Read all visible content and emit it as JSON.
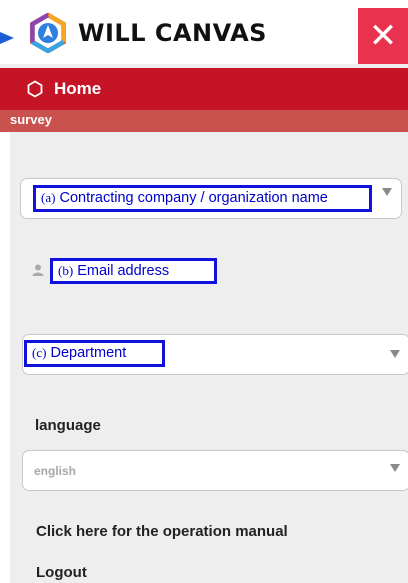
{
  "header": {
    "logo_text": "WILL CANVAS",
    "close_glyph": "✕",
    "colors": {
      "close_bg": "#e8324e",
      "nav_bg": "#c41425",
      "survey_bg": "#c9524f"
    }
  },
  "nav": {
    "home_label": "Home",
    "home_icon": "hexagon-outline-icon"
  },
  "survey_label": "survey",
  "fields": {
    "company": {
      "tag": "(a)",
      "label": "Contracting company / organization name"
    },
    "email": {
      "tag": "(b)",
      "label": "Email address",
      "icon": "person-icon"
    },
    "department": {
      "tag": "(c)",
      "label": "Department"
    }
  },
  "language": {
    "label": "language",
    "selected": "english"
  },
  "links": {
    "manual": "Click here for the operation manual",
    "logout": "Logout"
  }
}
